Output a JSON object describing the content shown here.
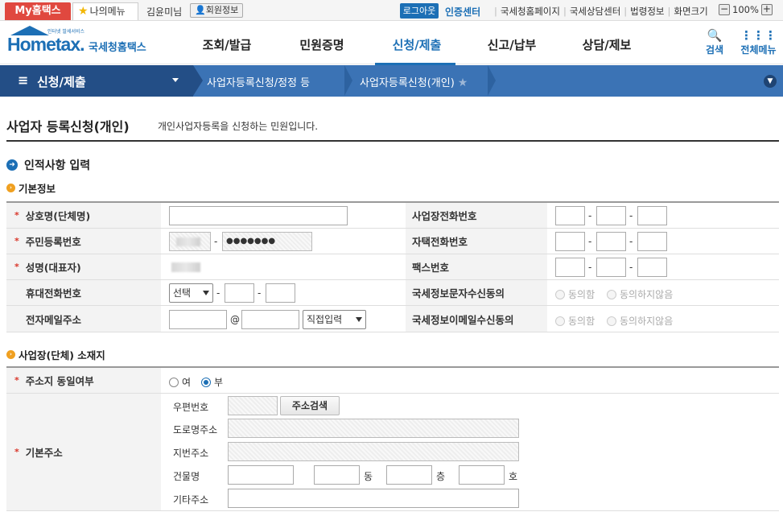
{
  "topbar": {
    "my_hometax": "My홈택스",
    "my_menu": "나의메뉴",
    "user_name": "김윤미님",
    "member_info": "회원정보",
    "logout": "로그아웃",
    "cert_center": "인증센터",
    "links": [
      "국세청홈페이지",
      "국세상담센터",
      "법령정보",
      "화면크기"
    ],
    "zoom_level": "100%"
  },
  "header": {
    "logo_text": "Hometax.",
    "logo_brand": "국세청홈택스",
    "logo_tagline": "인터넷 발세서비스",
    "gnb": [
      "조회/발급",
      "민원증명",
      "신청/제출",
      "신고/납부",
      "상담/제보"
    ],
    "active_gnb": "신청/제출",
    "search": "검색",
    "all_menu": "전체메뉴"
  },
  "navbar": {
    "menu": "신청/제출",
    "crumbs": [
      "사업자등록신청/정정 등",
      "사업자등록신청(개인)"
    ]
  },
  "page": {
    "title": "사업자 등록신청(개인)",
    "subtitle": "개인사업자등록을 신청하는 민원입니다."
  },
  "section_personal": {
    "heading": "인적사항 입력",
    "sub_heading": "기본정보",
    "fields": {
      "company_name": "상호명(단체명)",
      "rrn": "주민등록번호",
      "rrn_back": "●●●●●●●",
      "rep_name": "성명(대표자)",
      "mobile": "휴대전화번호",
      "mobile_select": "선택",
      "email": "전자메일주소",
      "email_at": "@",
      "email_select": "직접입력",
      "biz_phone": "사업장전화번호",
      "home_phone": "자택전화번호",
      "fax": "팩스번호",
      "sms_consent": "국세정보문자수신동의",
      "email_consent": "국세정보이메일수신동의",
      "agree": "동의함",
      "disagree": "동의하지않음",
      "dash": "-"
    }
  },
  "section_address": {
    "heading": "사업장(단체) 소재지",
    "same_address_label": "주소지 동일여부",
    "yes": "여",
    "no": "부",
    "selected": "부",
    "base_address_label": "기본주소",
    "zip_label": "우편번호",
    "search_btn": "주소검색",
    "road_label": "도로명주소",
    "lot_label": "지번주소",
    "building_label": "건물명",
    "dong": "동",
    "floor": "층",
    "ho": "호",
    "etc_label": "기타주소"
  },
  "colors": {
    "brand": "#1c6fb5",
    "my_tab": "#e0483f",
    "navbar": "#3b73b5",
    "navbar_dark": "#234e86",
    "required": "#d9372b"
  }
}
